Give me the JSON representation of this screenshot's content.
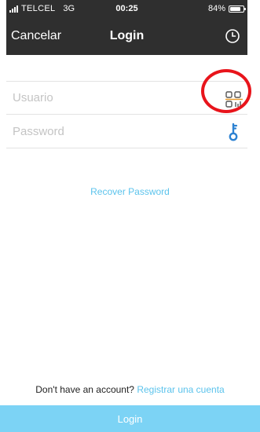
{
  "status_bar": {
    "carrier": "TELCEL",
    "network": "3G",
    "time": "00:25",
    "battery_percent": "84%",
    "battery_level": 0.84
  },
  "nav": {
    "cancel_label": "Cancelar",
    "title": "Login",
    "history_icon": "clock-icon"
  },
  "form": {
    "username_placeholder": "Usuario",
    "username_value": "",
    "username_icon": "barcode-scan-icon",
    "password_placeholder": "Password",
    "password_value": "",
    "password_icon": "key-icon",
    "recover_label": "Recover Password"
  },
  "footer": {
    "prompt": "Don't have an account? ",
    "register_label": "Registrar una cuenta",
    "login_label": "Login"
  },
  "colors": {
    "bar_bg": "#2f2f2f",
    "accent": "#5bc3ec",
    "login_button_bg": "#7cd3f5",
    "highlight": "#e8141b",
    "scan_icon_accent": "#e89a2c"
  }
}
